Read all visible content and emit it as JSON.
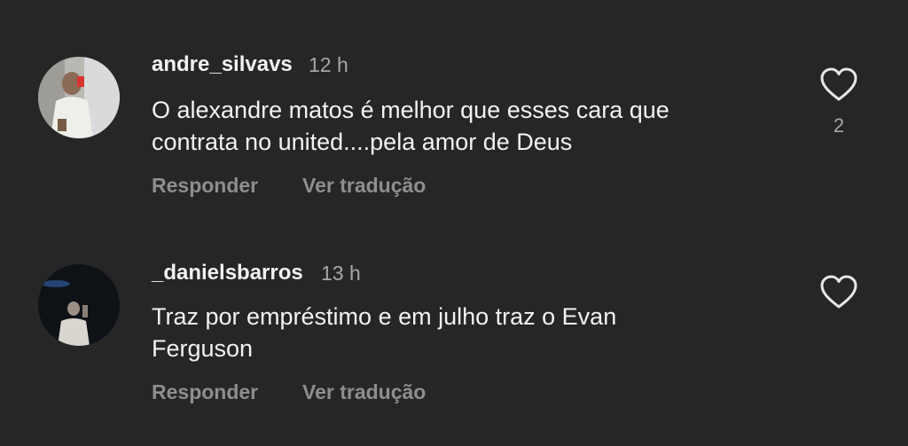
{
  "comments": [
    {
      "username": "andre_silvavs",
      "time": "12 h",
      "text_line1": "O alexandre matos é melhor que esses cara que",
      "text_line2": "contrata no united....pela amor de Deus",
      "reply_label": "Responder",
      "translate_label": "Ver tradução",
      "like_count": "2",
      "like_icon": "heart-outline-icon"
    },
    {
      "username": "_danielsbarros",
      "time": "13 h",
      "text_line1": "Traz por empréstimo e em julho traz o Evan",
      "text_line2": "Ferguson",
      "reply_label": "Responder",
      "translate_label": "Ver tradução",
      "like_icon": "heart-outline-icon"
    }
  ],
  "colors": {
    "background": "#262626",
    "primary_text": "#f2f2f2",
    "secondary_text": "#a8a8a8",
    "action_text": "#8e8e8e"
  }
}
